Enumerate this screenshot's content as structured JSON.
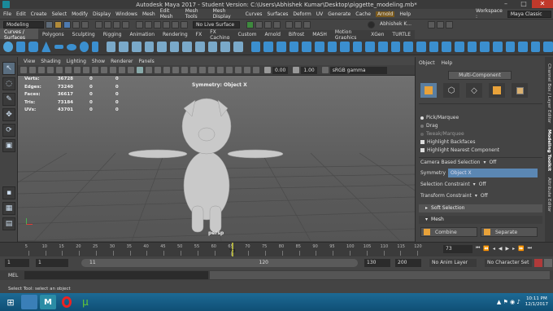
{
  "window": {
    "title": "Autodesk Maya 2017 - Student Version: C:\\Users\\Abhishek Kumar\\Desktop\\piggette_modeling.mb*"
  },
  "menubar": {
    "items": [
      "File",
      "Edit",
      "Create",
      "Select",
      "Modify",
      "Display",
      "Windows",
      "Mesh",
      "Edit Mesh",
      "Mesh Tools",
      "Mesh Display",
      "Curves",
      "Surfaces",
      "Deform",
      "UV",
      "Generate",
      "Cache"
    ],
    "arnold": "Arnold",
    "help": "Help",
    "workspace_label": "Workspace :",
    "workspace_value": "Maya Classic"
  },
  "statusline": {
    "mode": "Modeling",
    "live_surface": "No Live Surface",
    "user": "Abhishek K..."
  },
  "shelf_tabs": [
    "Curves / Surfaces",
    "Polygons",
    "Sculpting",
    "Rigging",
    "Animation",
    "Rendering",
    "FX",
    "FX Caching",
    "Custom",
    "Arnold",
    "Bifrost",
    "MASH",
    "Motion Graphics",
    "XGen",
    "TURTLE"
  ],
  "viewport": {
    "menu": [
      "View",
      "Shading",
      "Lighting",
      "Show",
      "Renderer",
      "Panels"
    ],
    "exposure": "0.00",
    "gamma": "1.00",
    "colorspace": "sRGB gamma",
    "hud_rows": [
      {
        "label": "Verts:",
        "a": "36728",
        "b": "0",
        "c": "0"
      },
      {
        "label": "Edges:",
        "a": "73240",
        "b": "0",
        "c": "0"
      },
      {
        "label": "Faces:",
        "a": "36617",
        "b": "0",
        "c": "0"
      },
      {
        "label": "Tris:",
        "a": "73184",
        "b": "0",
        "c": "0"
      },
      {
        "label": "UVs:",
        "a": "43701",
        "b": "0",
        "c": "0"
      }
    ],
    "symmetry": "Symmetry: Object X",
    "camera": "persp"
  },
  "modeling_toolkit": {
    "menu": [
      "Object",
      "Help"
    ],
    "mode": "Multi-Component",
    "pick_marquee": "Pick/Marquee",
    "drag": "Drag",
    "tweak_marquee": "Tweak/Marquee",
    "highlight_backfaces": "Highlight Backfaces",
    "highlight_nearest": "Highlight Nearest Component",
    "camera_based_selection": "Camera Based Selection",
    "camera_based_value": "Off",
    "symmetry_label": "Symmetry",
    "symmetry_value": "Object X",
    "selection_constraint": "Selection Constraint",
    "selection_constraint_value": "Off",
    "transform_constraint": "Transform Constraint",
    "transform_constraint_value": "Off",
    "soft_selection": "Soft Selection",
    "mesh_section": "Mesh",
    "combine": "Combine",
    "separate": "Separate"
  },
  "side_tabs": [
    "Channel Box / Layer Editor",
    "Modeling Toolkit",
    "Attribute Editor"
  ],
  "timeline": {
    "ticks": [
      "5",
      "10",
      "15",
      "20",
      "25",
      "30",
      "35",
      "40",
      "45",
      "50",
      "55",
      "60",
      "65",
      "70",
      "75",
      "80",
      "85",
      "90",
      "95",
      "100",
      "105",
      "110",
      "115",
      "120"
    ],
    "current_marker": "73",
    "current_frame": "73"
  },
  "range": {
    "start": "1",
    "start2": "1",
    "slider_start": "11",
    "slider_end": "120",
    "end": "130",
    "end2": "200",
    "anim_layer": "No Anim Layer",
    "character_set": "No Character Set"
  },
  "cmdline": {
    "label": "MEL"
  },
  "helpline": {
    "text": "Select Tool: select an object"
  },
  "taskbar": {
    "time": "10:11 PM",
    "date": "12/1/2017"
  }
}
